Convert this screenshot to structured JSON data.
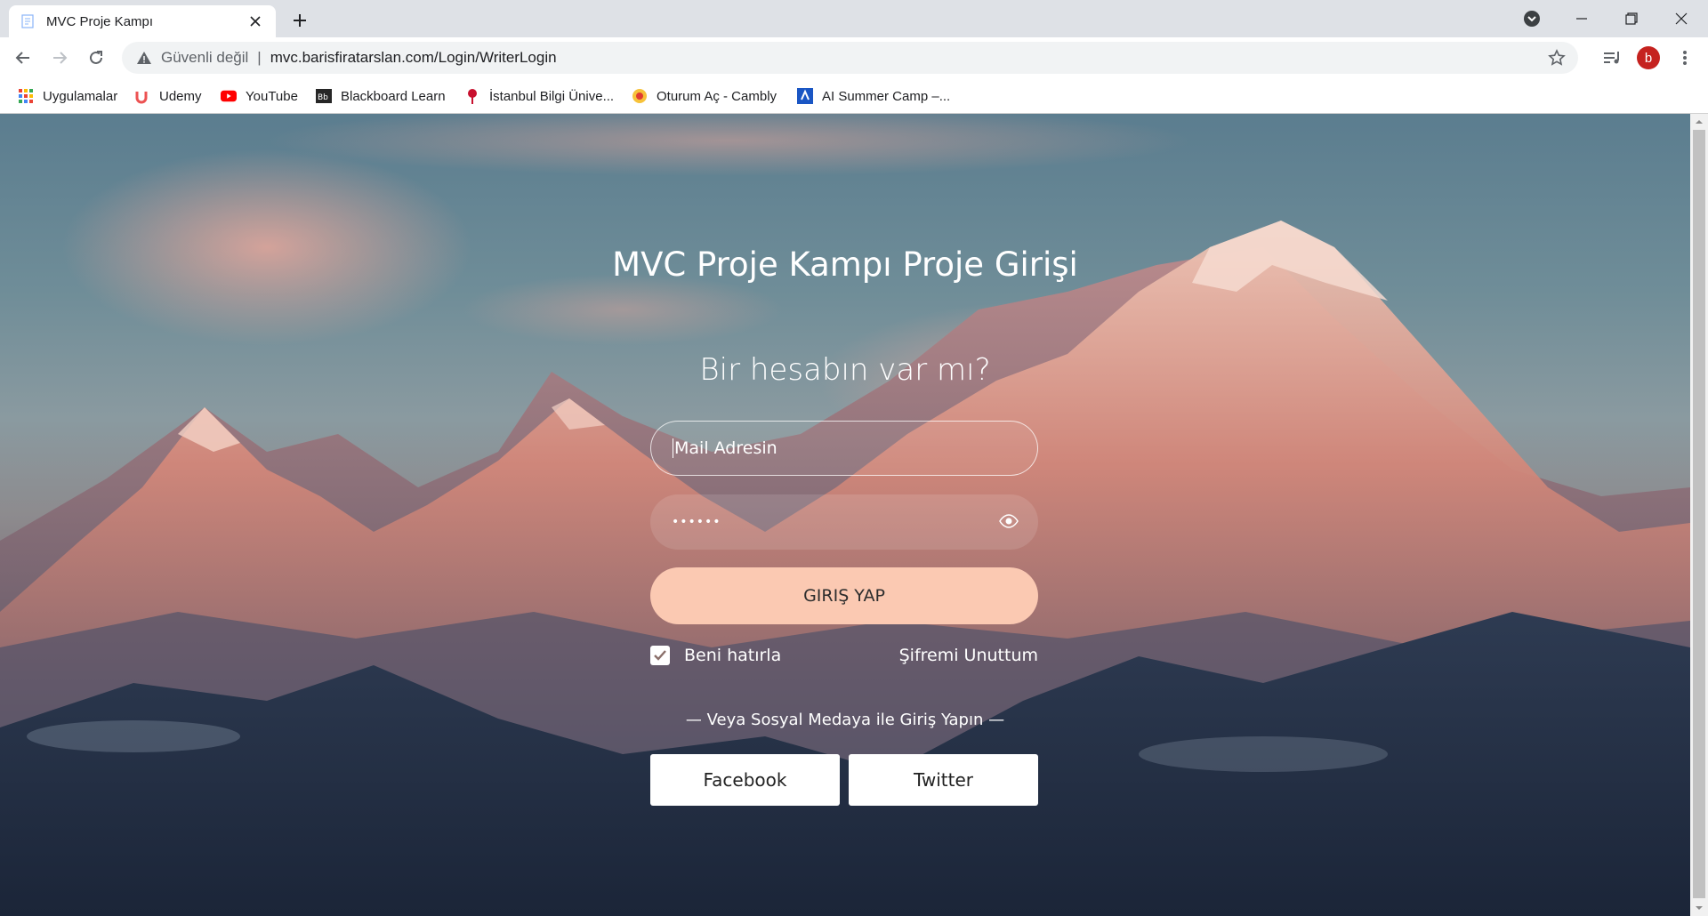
{
  "browser": {
    "tab_title": "MVC Proje Kampı",
    "security_label": "Güvenli değil",
    "separator": "|",
    "url": "mvc.barisfiratarslan.com/Login/WriterLogin",
    "profile_initial": "b"
  },
  "bookmarks": [
    {
      "label": "Uygulamalar",
      "icon": "apps-grid-icon"
    },
    {
      "label": "Udemy",
      "icon": "udemy-icon"
    },
    {
      "label": "YouTube",
      "icon": "youtube-icon"
    },
    {
      "label": "Blackboard Learn",
      "icon": "blackboard-icon"
    },
    {
      "label": "İstanbul Bilgi Ünive...",
      "icon": "bilgi-icon"
    },
    {
      "label": "Oturum Aç - Cambly",
      "icon": "cambly-icon"
    },
    {
      "label": "AI Summer Camp –...",
      "icon": "ai-camp-icon"
    }
  ],
  "page": {
    "title": "MVC Proje Kampı Proje Girişi",
    "subtitle": "Bir hesabın var mı?",
    "email_placeholder": "Mail Adresin",
    "password_mask": "••••••",
    "login_button": "GIRIŞ YAP",
    "remember_label": "Beni hatırla",
    "remember_checked": true,
    "forgot_label": "Şifremi Unuttum",
    "social_label": "— Veya Sosyal Medaya ile Giriş Yapın —",
    "facebook_label": "Facebook",
    "twitter_label": "Twitter"
  },
  "colors": {
    "login_button": "#fbc9b2",
    "avatar": "#c5221f"
  }
}
